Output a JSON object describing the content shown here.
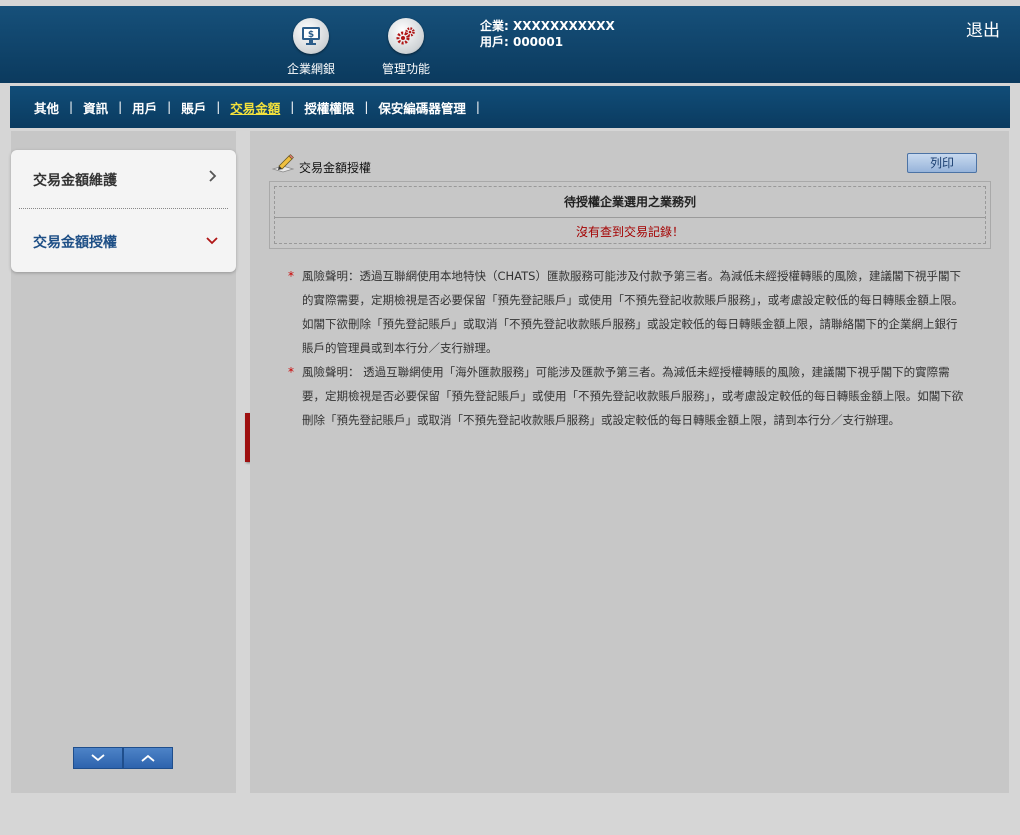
{
  "header": {
    "buttons": [
      {
        "label": "企業網銀",
        "icon": "monitor-dollar-icon"
      },
      {
        "label": "管理功能",
        "icon": "gears-icon"
      }
    ],
    "company_line": "企業: XXXXXXXXXXX",
    "user_line": "用戶: 000001",
    "logout_label": "退出"
  },
  "nav": {
    "items": [
      "其他",
      "資訊",
      "用戶",
      "賬戶",
      "交易金額",
      "授權權限",
      "保安編碼器管理"
    ],
    "active": "交易金額"
  },
  "sidebar": {
    "items": [
      {
        "label": "交易金額維護",
        "chevron": "chevron-right-icon"
      },
      {
        "label": "交易金額授權",
        "chevron": "chevron-down-icon"
      }
    ]
  },
  "main": {
    "title": "交易金額授權",
    "print_label": "列印",
    "table_header": "待授權企業選用之業務列",
    "empty_message": "沒有查到交易記錄！",
    "notes": [
      "風險聲明：透過互聯網使用本地特快（CHATS）匯款服務可能涉及付款予第三者。為減低未經授權轉賬的風險，建議閣下視乎閣下的實際需要，定期檢視是否必要保留「預先登記賬戶」或使用「不預先登記收款賬戶服務」，或考慮設定較低的每日轉賬金額上限。如閣下欲刪除「預先登記賬戶」或取消「不預先登記收款賬戶服務」或設定較低的每日轉賬金額上限，請聯絡閣下的企業網上銀行賬戶的管理員或到本行分／支行辦理。",
      "風險聲明： 透過互聯網使用「海外匯款服務」可能涉及匯款予第三者。為減低未經授權轉賬的風險，建議閣下視乎閣下的實際需要，定期檢視是否必要保留「預先登記賬戶」或使用「不預先登記收款賬戶服務」，或考慮設定較低的每日轉賬金額上限。如閣下欲刪除「預先登記賬戶」或取消「不預先登記收款賬戶服務」或設定較低的每日轉賬金額上限，請到本行分／支行辦理。"
    ]
  },
  "colors": {
    "header_blue": "#0b3a5e",
    "active_nav": "#f3e13c",
    "sidebar_link": "#1e4f86",
    "error_red": "#a40000",
    "collapse_tab": "#9e1010"
  }
}
